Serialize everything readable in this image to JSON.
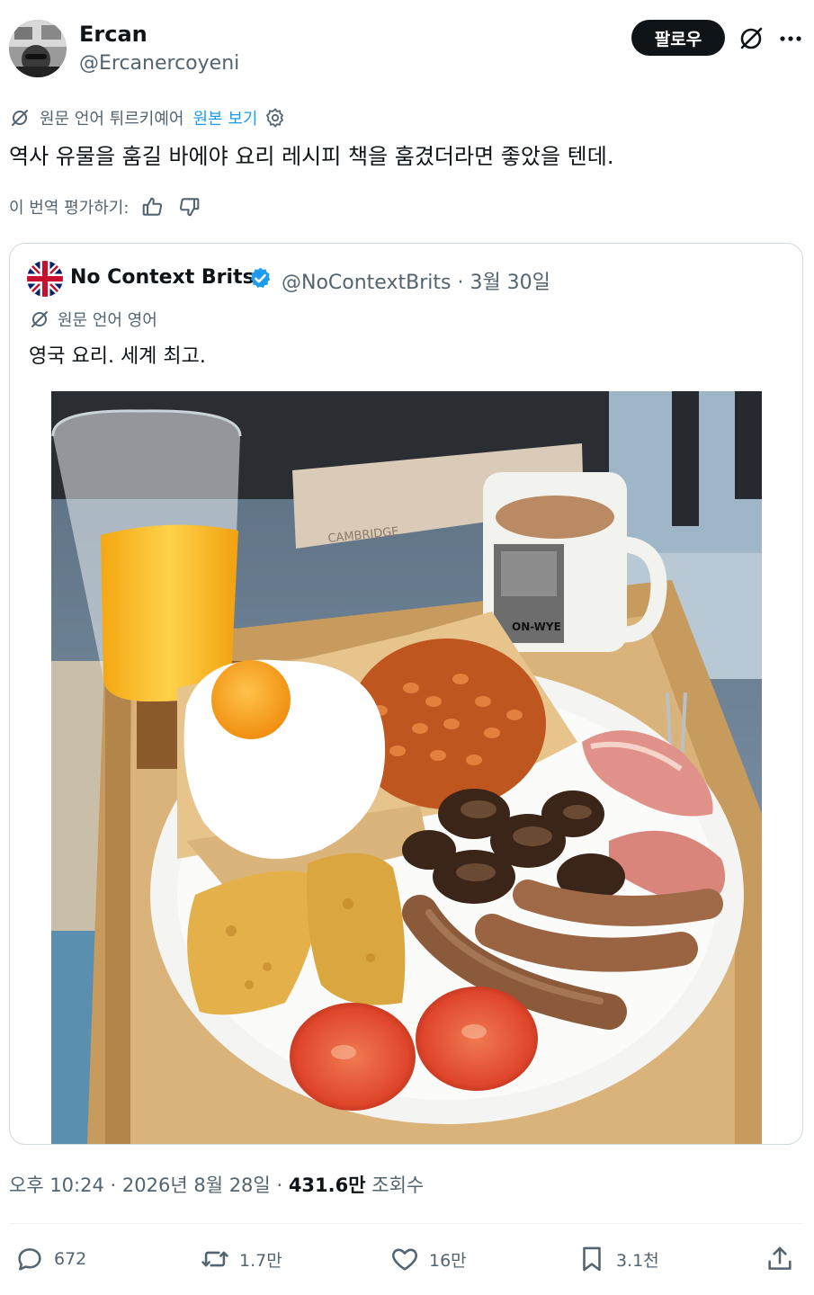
{
  "post": {
    "author_name": "Ercan",
    "author_handle": "@Ercanercoyeni",
    "follow_label": "팔로우",
    "translation": {
      "source_lang_text": "원문 언어 튀르키예어",
      "show_original_label": "원본 보기"
    },
    "text": "역사 유물을 훔길 바에야 요리 레시피 책을 훔겼더라면 좋았을 텐데.",
    "rate_translation_label": "이 번역 평가하기:",
    "timestamp": {
      "time": "오후 10:24",
      "separator": "·",
      "date": "2026년 8월 28일",
      "views_value": "431.6만",
      "views_label": "조회수"
    }
  },
  "quoted": {
    "author_name": "No Context Brits",
    "author_handle": "@NoContextBrits",
    "date": "3월 30일",
    "meta_separator": "·",
    "translation_text": "원문 언어 영어",
    "text": "영국 요리. 세계 최고.",
    "photo": {
      "mug_text": "ON-WYE",
      "box_text": "CAMBRIDGE"
    }
  },
  "actions": {
    "replies": "672",
    "reposts": "1.7만",
    "likes": "16만",
    "bookmarks": "3.1천"
  },
  "colors": {
    "text_primary": "#0f1419",
    "text_secondary": "#536471",
    "link": "#1d9bf0",
    "verified": "#1d9bf0",
    "border": "#cfd9de"
  },
  "icons": [
    "grok-icon",
    "more-icon",
    "translate-icon",
    "settings-icon",
    "thumbs-up-icon",
    "thumbs-down-icon",
    "verified-badge-icon",
    "reply-icon",
    "repost-icon",
    "like-icon",
    "bookmark-icon",
    "share-icon"
  ]
}
